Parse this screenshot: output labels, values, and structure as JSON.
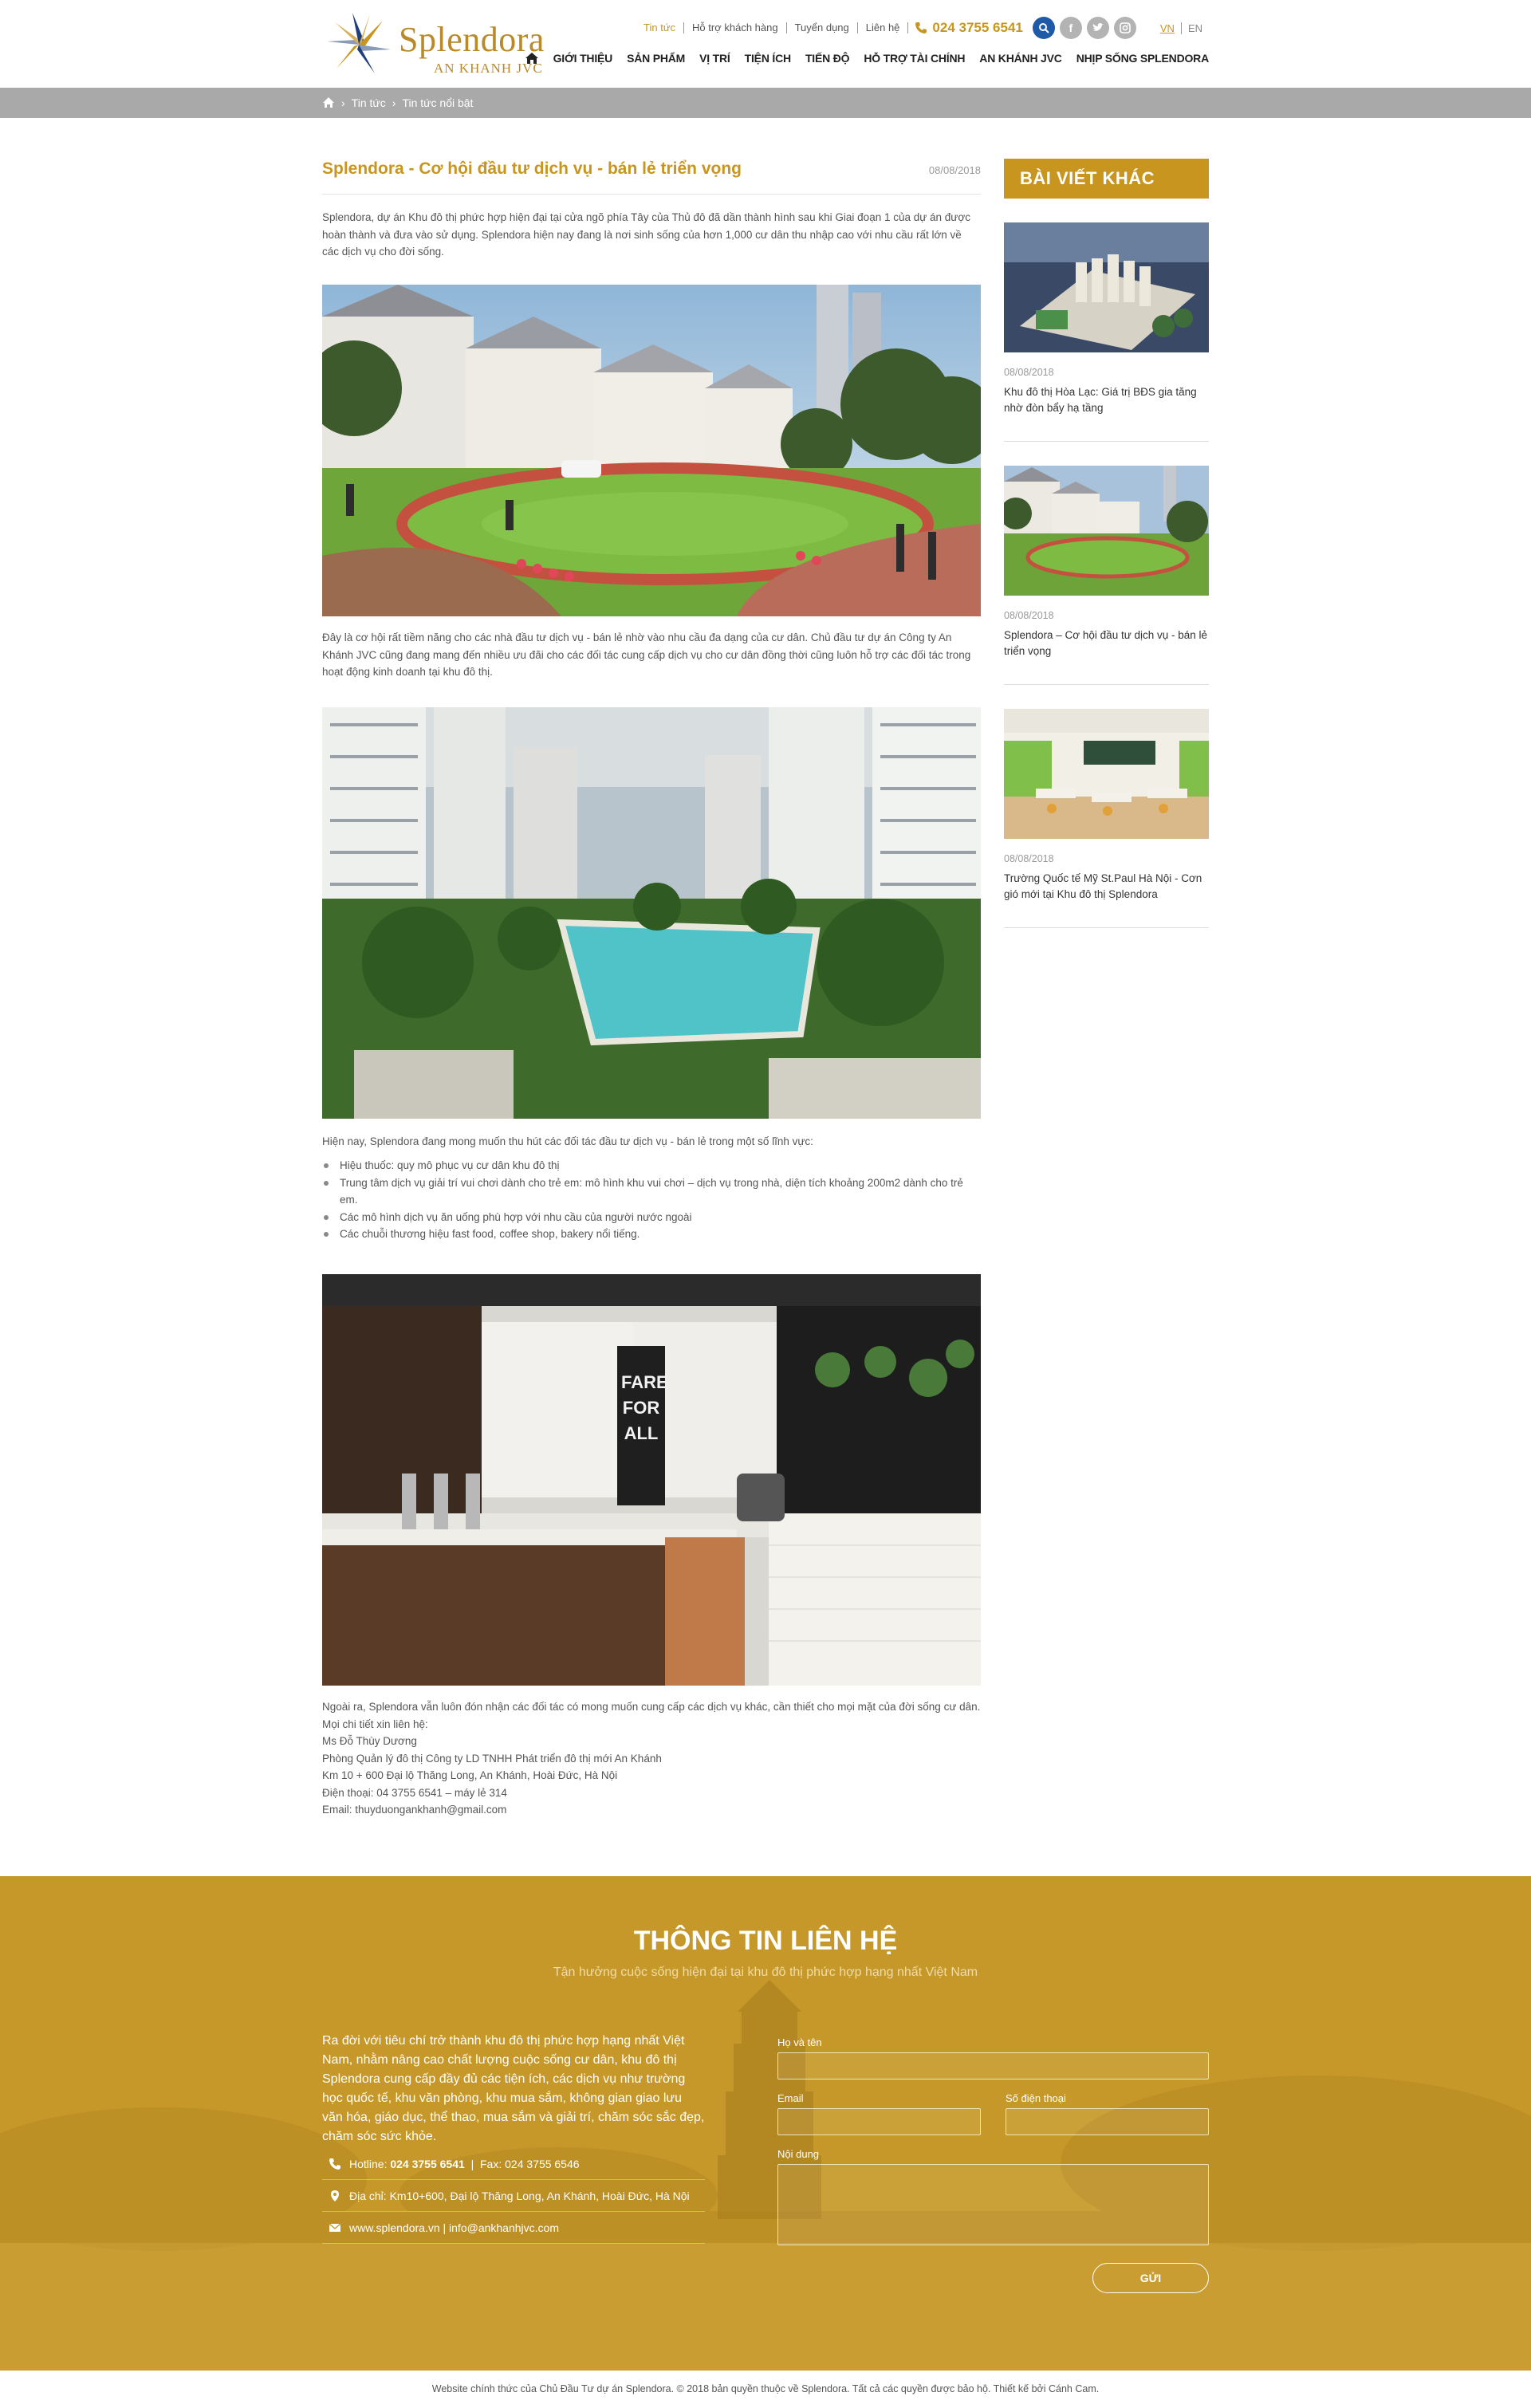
{
  "header": {
    "logo": {
      "name": "Splendora",
      "sub": "AN KHANH JVC"
    },
    "top_links": [
      {
        "label": "Tin tức",
        "active": true
      },
      {
        "label": "Hỗ trợ khách hàng",
        "active": false
      },
      {
        "label": "Tuyển dụng",
        "active": false
      },
      {
        "label": "Liên hệ",
        "active": false
      }
    ],
    "hotline": "024 3755 6541",
    "social_icons": [
      "facebook-icon",
      "twitter-icon",
      "instagram-icon"
    ],
    "lang": {
      "vn": "VN",
      "en": "EN"
    },
    "nav": [
      {
        "label": "GIỚI THIỆU"
      },
      {
        "label": "SẢN PHẨM"
      },
      {
        "label": "VỊ TRÍ"
      },
      {
        "label": "TIỆN ÍCH"
      },
      {
        "label": "TIẾN ĐỘ"
      },
      {
        "label": "HỖ TRỢ TÀI CHÍNH"
      },
      {
        "label": "AN KHÁNH JVC"
      },
      {
        "label": "NHỊP SỐNG SPLENDORA"
      }
    ]
  },
  "breadcrumb": [
    "Tin tức",
    "Tin tức nổi bật"
  ],
  "article": {
    "title": "Splendora - Cơ hội đầu tư dịch vụ - bán lẻ triển vọng",
    "date": "08/08/2018",
    "p1": "Splendora, dự án Khu đô thị phức hợp hiện đại tại cửa ngõ phía Tây của Thủ đô đã dần thành hình sau khi Giai đoạn 1 của dự án được hoàn thành và đưa vào sử dụng. Splendora hiện nay đang là nơi sinh sống của hơn 1,000 cư dân thu nhập cao với nhu cầu rất lớn về các dịch vụ cho đời sống.",
    "p2": "Đây là cơ hội rất tiềm năng cho các nhà đầu tư dịch vụ - bán lẻ nhờ vào nhu cầu đa dạng của cư dân. Chủ đầu tư dự án Công ty An Khánh JVC cũng đang mang đến nhiều ưu đãi cho các đối tác cung cấp dịch vụ cho cư dân đồng thời cũng luôn hỗ trợ các đối tác trong hoạt động kinh doanh tại khu đô thị.",
    "p3": "Hiện nay, Splendora đang mong muốn thu hút các đối tác đầu tư dịch vụ - bán lẻ trong một số lĩnh vực:",
    "bullets": [
      "Hiệu thuốc: quy mô phục vụ cư dân khu đô thị",
      "Trung tâm dịch vụ giải trí vui chơi dành cho trẻ em: mô hình khu vui chơi – dịch vụ trong nhà, diện tích khoảng 200m2 dành cho trẻ em.",
      "Các mô hình dịch vụ ăn uống phù hợp với nhu cầu của người nước ngoài",
      "Các chuỗi thương hiệu fast food, coffee shop, bakery nổi tiếng."
    ],
    "p4": "Ngoài ra, Splendora vẫn luôn đón nhận các đối tác có mong muốn cung cấp các dịch vụ khác, cần thiết cho mọi mặt của đời sống cư dân. Mọi chi tiết xin liên hệ:",
    "contact_lines": [
      "Ms Đỗ Thùy Dương",
      "Phòng Quản lý đô thị Công ty LD TNHH Phát triển đô thị mới An Khánh",
      "Km 10 + 600 Đại lộ Thăng Long, An Khánh, Hoài Đức, Hà Nội",
      "Điện thoại: 04 3755 6541 – máy lẻ 314",
      "Email: thuyduongankhanh@gmail.com"
    ],
    "cafe_sign": [
      "FARE",
      "FOR",
      "ALL"
    ]
  },
  "sidebar": {
    "title": "BÀI VIẾT KHÁC",
    "items": [
      {
        "date": "08/08/2018",
        "title": "Khu đô thị Hòa Lạc: Giá trị BĐS gia tăng nhờ đòn bẩy hạ tầng"
      },
      {
        "date": "08/08/2018",
        "title": "Splendora – Cơ hội đầu tư dịch vụ - bán lẻ triển vọng"
      },
      {
        "date": "08/08/2018",
        "title": "Trường Quốc tế Mỹ St.Paul Hà Nội - Cơn gió mới tại Khu đô thị Splendora"
      }
    ]
  },
  "contact": {
    "title": "THÔNG TIN LIÊN HỆ",
    "subtitle": "Tận hưởng cuộc sống hiện đại tại khu đô thị phức hợp hạng nhất Việt Nam",
    "description": "Ra đời với tiêu chí trở thành khu đô thị phức hợp hạng nhất Việt Nam, nhằm nâng cao chất lượng cuộc sống cư dân, khu đô thị Splendora cung cấp đầy đủ các tiện ích, các dịch vụ như trường học quốc tế, khu văn phòng, khu mua sắm, không gian giao lưu văn hóa, giáo dục, thể thao, mua sắm và giải trí, chăm sóc sắc đẹp, chăm sóc sức khỏe.",
    "hotline_label": "Hotline:",
    "hotline": "024 3755 6541",
    "fax": "Fax: 024 3755 6546",
    "address": "Địa chỉ: Km10+600, Đại lộ Thăng Long, An Khánh, Hoài Đức, Hà Nội",
    "web": "www.splendora.vn | info@ankhanhjvc.com",
    "form": {
      "name": "Họ và tên",
      "email": "Email",
      "phone": "Số điện thoại",
      "message": "Nội dung",
      "send": "GỬI"
    }
  },
  "footer": {
    "copyright": "Website chính thức của Chủ Đầu Tư dự án Splendora. © 2018 bản quyền thuộc về Splendora. Tất cả các quyền được bảo hộ. Thiết kế bởi Cánh Cam."
  },
  "colors": {
    "gold": "#c8961e",
    "footer_gold": "#c69829",
    "breadcrumb_gray": "#a9a9a9",
    "search_blue": "#1e5aa8"
  }
}
